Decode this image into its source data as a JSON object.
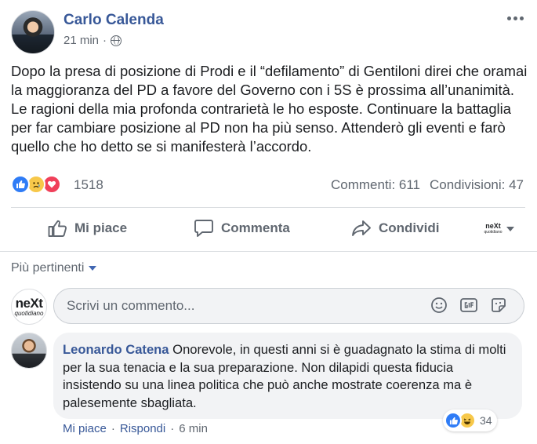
{
  "post": {
    "author": "Carlo Calenda",
    "timestamp": "21 min",
    "privacy_icon": "globe-icon",
    "text": "Dopo la presa di posizione di Prodi e il “defilamento” di Gentiloni direi che oramai la maggioranza del PD a favore del Governo con i 5S è prossima all’unanimità. Le ragioni della mia profonda contrarietà le ho esposte. Continuare la battaglia per far cambiare posizione al PD non ha più senso. Attenderò gli eventi e farò quello che ho detto se si manifesterà l’accordo."
  },
  "stats": {
    "reaction_icons": [
      "like-icon",
      "sad-icon",
      "love-icon"
    ],
    "reaction_count": "1518",
    "comments": "Commenti: 611",
    "shares": "Condivisioni: 47"
  },
  "actions": {
    "like": "Mi piace",
    "comment": "Commenta",
    "share": "Condividi",
    "page_logo_top": "neXt",
    "page_logo_bottom": "quotidiano"
  },
  "comments_section": {
    "sort_label": "Più pertinenti",
    "composer_placeholder": "Scrivi un commento...",
    "composer_logo_top": "neXt",
    "composer_logo_bottom": "quotidiano",
    "composer_icons": [
      "emoji-icon",
      "gif-icon",
      "sticker-icon"
    ]
  },
  "comment": {
    "author": "Leonardo Catena",
    "text": "Onorevole, in questi anni si è guadagnato la stima di molti per la sua tenacia e la sua preparazione. Non dilapidi questa fiducia insistendo su una linea politica che può anche mostrate coerenza ma è palesemente sbagliata.",
    "reaction_count": "34",
    "like_label": "Mi piace",
    "reply_label": "Rispondi",
    "timestamp": "6 min",
    "separator": "·"
  },
  "colors": {
    "link_blue": "#385898",
    "secondary_text": "#606770",
    "like_blue": "#2f7cf6",
    "love_red": "#f0405a",
    "emoji_yellow": "#f7c84a"
  }
}
